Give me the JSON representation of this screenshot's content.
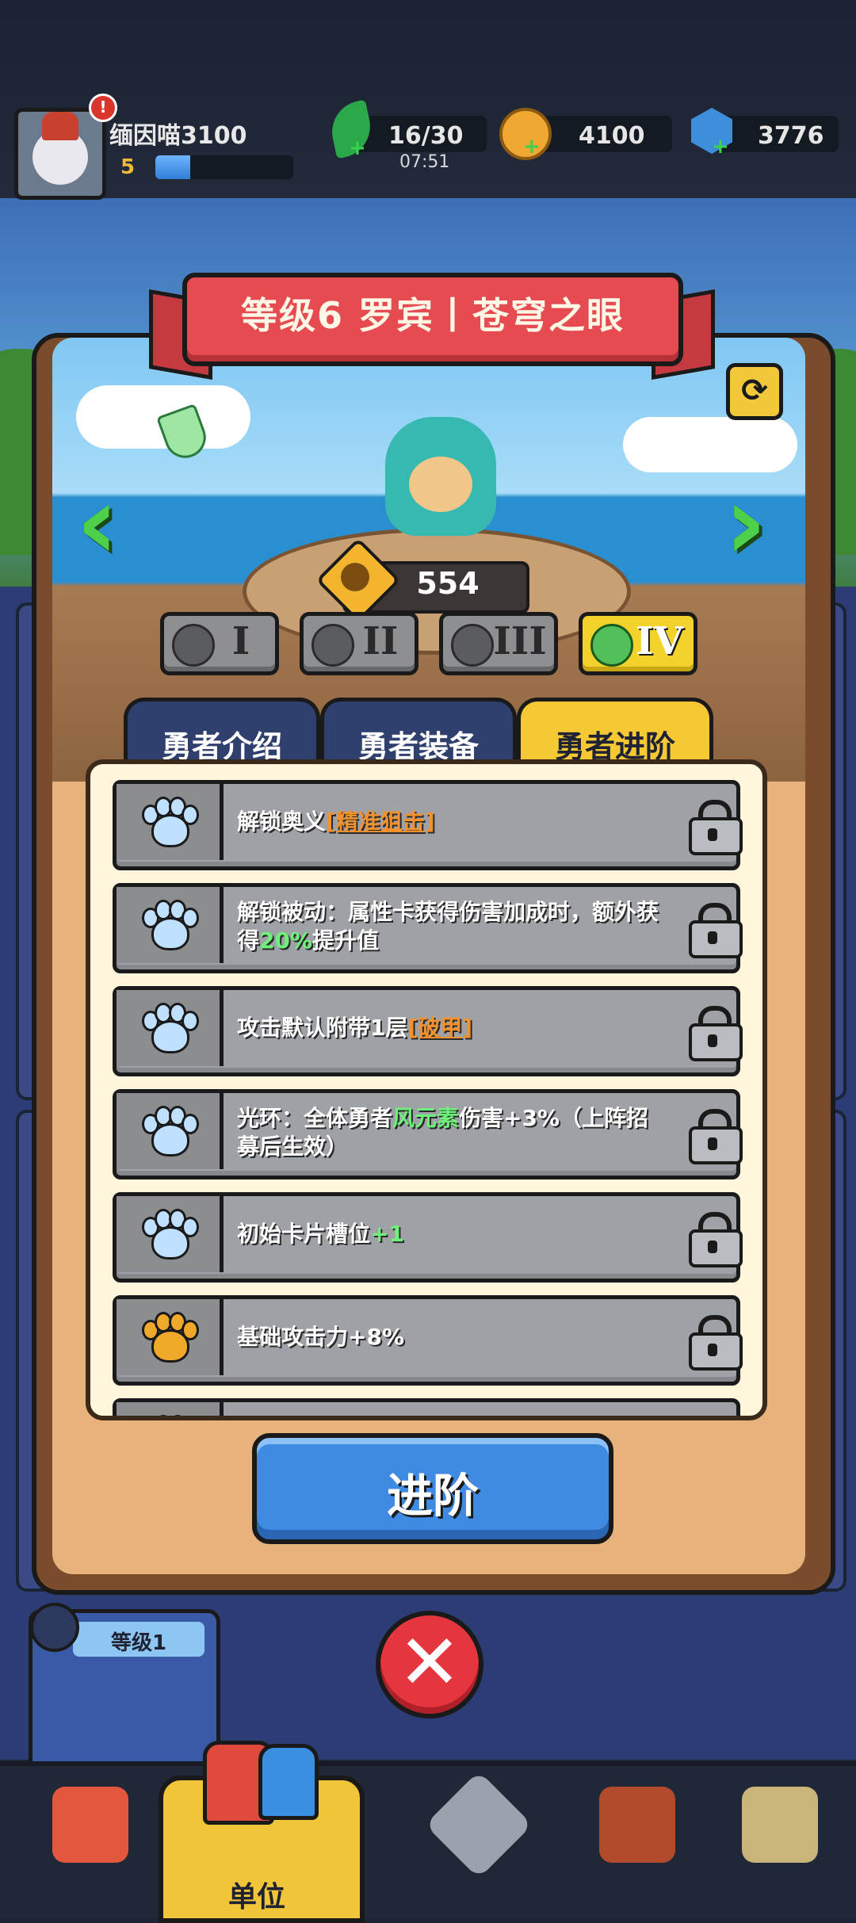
{
  "player": {
    "name": "缅因喵3100",
    "level": "5",
    "xp_fraction": 0.25
  },
  "resources": {
    "energy": "16/30",
    "energy_timer": "07:51",
    "coins": "4100",
    "gems": "3776"
  },
  "hero": {
    "title": "等级6 罗宾丨苍穹之眼",
    "power": "554"
  },
  "tiers": [
    {
      "label": "I",
      "active": false
    },
    {
      "label": "II",
      "active": false
    },
    {
      "label": "III",
      "active": false
    },
    {
      "label": "IV",
      "active": true
    }
  ],
  "tabs": [
    {
      "label": "勇者介绍",
      "active": false
    },
    {
      "label": "勇者装备",
      "active": false
    },
    {
      "label": "勇者进阶",
      "active": true
    }
  ],
  "advancements": [
    {
      "paw": "blue",
      "prefix": "解锁奥义",
      "highlight": "[精准狙击]",
      "highlight_color": "orange",
      "suffix": "",
      "locked": true
    },
    {
      "paw": "blue",
      "prefix": "解锁被动：属性卡获得伤害加成时，额外获得",
      "highlight": "20%",
      "highlight_color": "green",
      "suffix": "提升值",
      "locked": true
    },
    {
      "paw": "blue",
      "prefix": "攻击默认附带1层",
      "highlight": "[破甲]",
      "highlight_color": "orange",
      "suffix": "",
      "locked": true
    },
    {
      "paw": "blue",
      "prefix": "光环：全体勇者",
      "highlight": "风元素",
      "highlight_color": "green",
      "suffix": "伤害+3%（上阵招募后生效）",
      "locked": true
    },
    {
      "paw": "blue",
      "prefix": "初始卡片槽位",
      "highlight": "+1",
      "highlight_color": "green",
      "suffix": "",
      "locked": true
    },
    {
      "paw": "gold",
      "prefix": "基础攻击力+8%",
      "highlight": "",
      "highlight_color": "",
      "suffix": "",
      "locked": true
    },
    {
      "paw": "gold",
      "prefix": "",
      "highlight": "",
      "highlight_color": "",
      "suffix": "",
      "locked": true
    }
  ],
  "buttons": {
    "advance": "进阶"
  },
  "unit_card": {
    "level": "等级1"
  },
  "bottom_nav": {
    "units_label": "单位"
  },
  "colors": {
    "accent_yellow": "#f6c834",
    "banner_red": "#e64b52",
    "button_blue": "#3f8be3",
    "highlight_green": "#6ff07a",
    "highlight_orange": "#f3912e"
  }
}
